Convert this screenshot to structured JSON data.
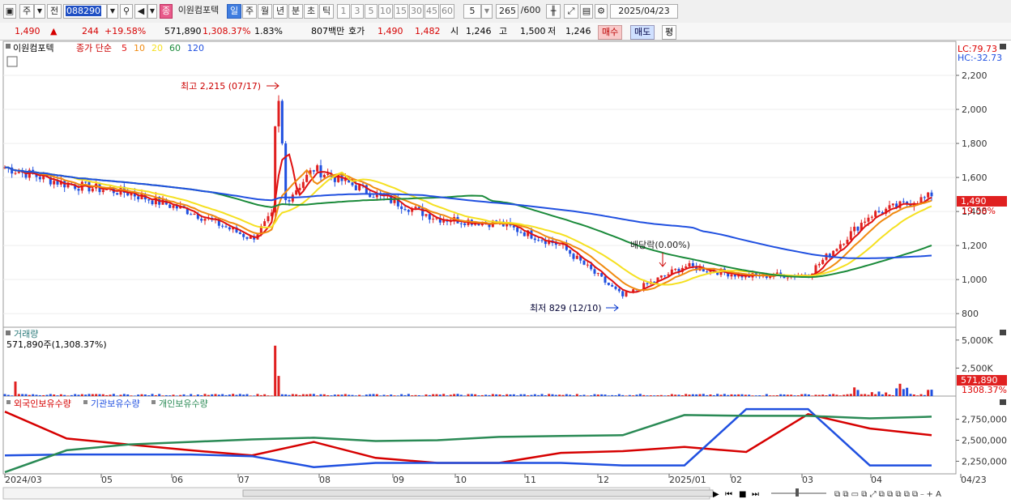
{
  "toolbar": {
    "market": "주",
    "prev": "전",
    "code": "088290",
    "stock_badge": "종",
    "stock_name": "이원컴포텍",
    "periods": [
      "일",
      "주",
      "월",
      "년",
      "분",
      "초",
      "틱"
    ],
    "active_period": "일",
    "intervals": [
      "1",
      "3",
      "5",
      "10",
      "15",
      "30",
      "45",
      "60"
    ],
    "interval_value": "5",
    "count": "265",
    "count_total": "/600",
    "date": "2025/04/23"
  },
  "quote": {
    "price": "1,490",
    "change": "244",
    "change_pct": "+19.58%",
    "volume": "571,890",
    "volume_pct": "1,308.37%",
    "turnover_pct": "1.83%",
    "amount": "807백만",
    "bid_label": "호가",
    "ask": "1,490",
    "bid": "1,482",
    "open_label": "시",
    "open": "1,246",
    "high_label": "고",
    "high": "1,500",
    "low_label": "저",
    "low": "1,246",
    "buy_label": "매수",
    "sell_label": "매도",
    "avg_label": "평"
  },
  "price_panel": {
    "title": "이원컴포텍",
    "ma_label": "종가 단순",
    "ma_periods": [
      "5",
      "10",
      "20",
      "60",
      "120"
    ],
    "ma_colors": [
      "#e01010",
      "#f08a10",
      "#f5e020",
      "#1a8a3a",
      "#2050e0"
    ],
    "lc": "LC:79.73",
    "hc": "HC:-32.73",
    "annotation_high": "최고 2,215 (07/17)",
    "annotation_low": "최저 829 (12/10)",
    "annotation_div": "배당락(0.00%)",
    "last_price_tag": "1,490",
    "last_pct_tag": "19.58%"
  },
  "volume_panel": {
    "title": "거래량",
    "info": "571,890주(1,308.37%)",
    "last_tag": "571,890",
    "last_pct_tag": "1308.37%"
  },
  "holding_panel": {
    "series": [
      {
        "name": "외국인보유수량",
        "color": "#d60000"
      },
      {
        "name": "기관보유수량",
        "color": "#2050e0"
      },
      {
        "name": "개인보유수량",
        "color": "#2a8a55"
      }
    ]
  },
  "x_axis_labels": [
    "2024/03",
    "05",
    "06",
    "07",
    "08",
    "09",
    "10",
    "11",
    "12",
    "2025/01",
    "02",
    "03",
    "04",
    "04/23"
  ],
  "chart_data": [
    {
      "type": "candlestick",
      "title": "이원컴포텍",
      "ylim": [
        720,
        2400
      ],
      "y_ticks": [
        "800",
        "1,000",
        "1,200",
        "1,400",
        "1,600",
        "1,800",
        "2,000",
        "2,200"
      ],
      "x": [
        "2024/03",
        "04",
        "05",
        "06",
        "07",
        "07/17",
        "08",
        "09",
        "10",
        "11",
        "12/10",
        "2025/01",
        "02",
        "03",
        "04",
        "04/23"
      ],
      "close": [
        1660,
        1560,
        1510,
        1400,
        1240,
        1650,
        1500,
        1360,
        1330,
        1200,
        900,
        1080,
        1020,
        1030,
        1380,
        1490
      ],
      "annotations": [
        "최고 2,215 (07/17)",
        "최저 829 (12/10)",
        "배당락(0.00%)"
      ]
    },
    {
      "type": "bar",
      "title": "거래량",
      "y_ticks": [
        "2,500K",
        "5,000K"
      ],
      "last_value": 571890
    },
    {
      "type": "line",
      "y_ticks": [
        "2,250,000",
        "2,500,000",
        "2,750,000"
      ],
      "series": [
        {
          "name": "외국인보유수량",
          "values": [
            2840000,
            2520000,
            2450000,
            2380000,
            2320000,
            2480000,
            2290000,
            2230000,
            2230000,
            2350000,
            2370000,
            2420000,
            2360000,
            2810000,
            2640000,
            2560000
          ]
        },
        {
          "name": "기관보유수량",
          "values": [
            2320000,
            2330000,
            2330000,
            2330000,
            2310000,
            2180000,
            2230000,
            2230000,
            2230000,
            2230000,
            2200000,
            2200000,
            2870000,
            2870000,
            2200000,
            2200000
          ]
        },
        {
          "name": "개인보유수량",
          "values": [
            2120000,
            2380000,
            2450000,
            2480000,
            2510000,
            2530000,
            2490000,
            2500000,
            2540000,
            2550000,
            2560000,
            2800000,
            2790000,
            2790000,
            2760000,
            2780000
          ]
        }
      ]
    }
  ]
}
